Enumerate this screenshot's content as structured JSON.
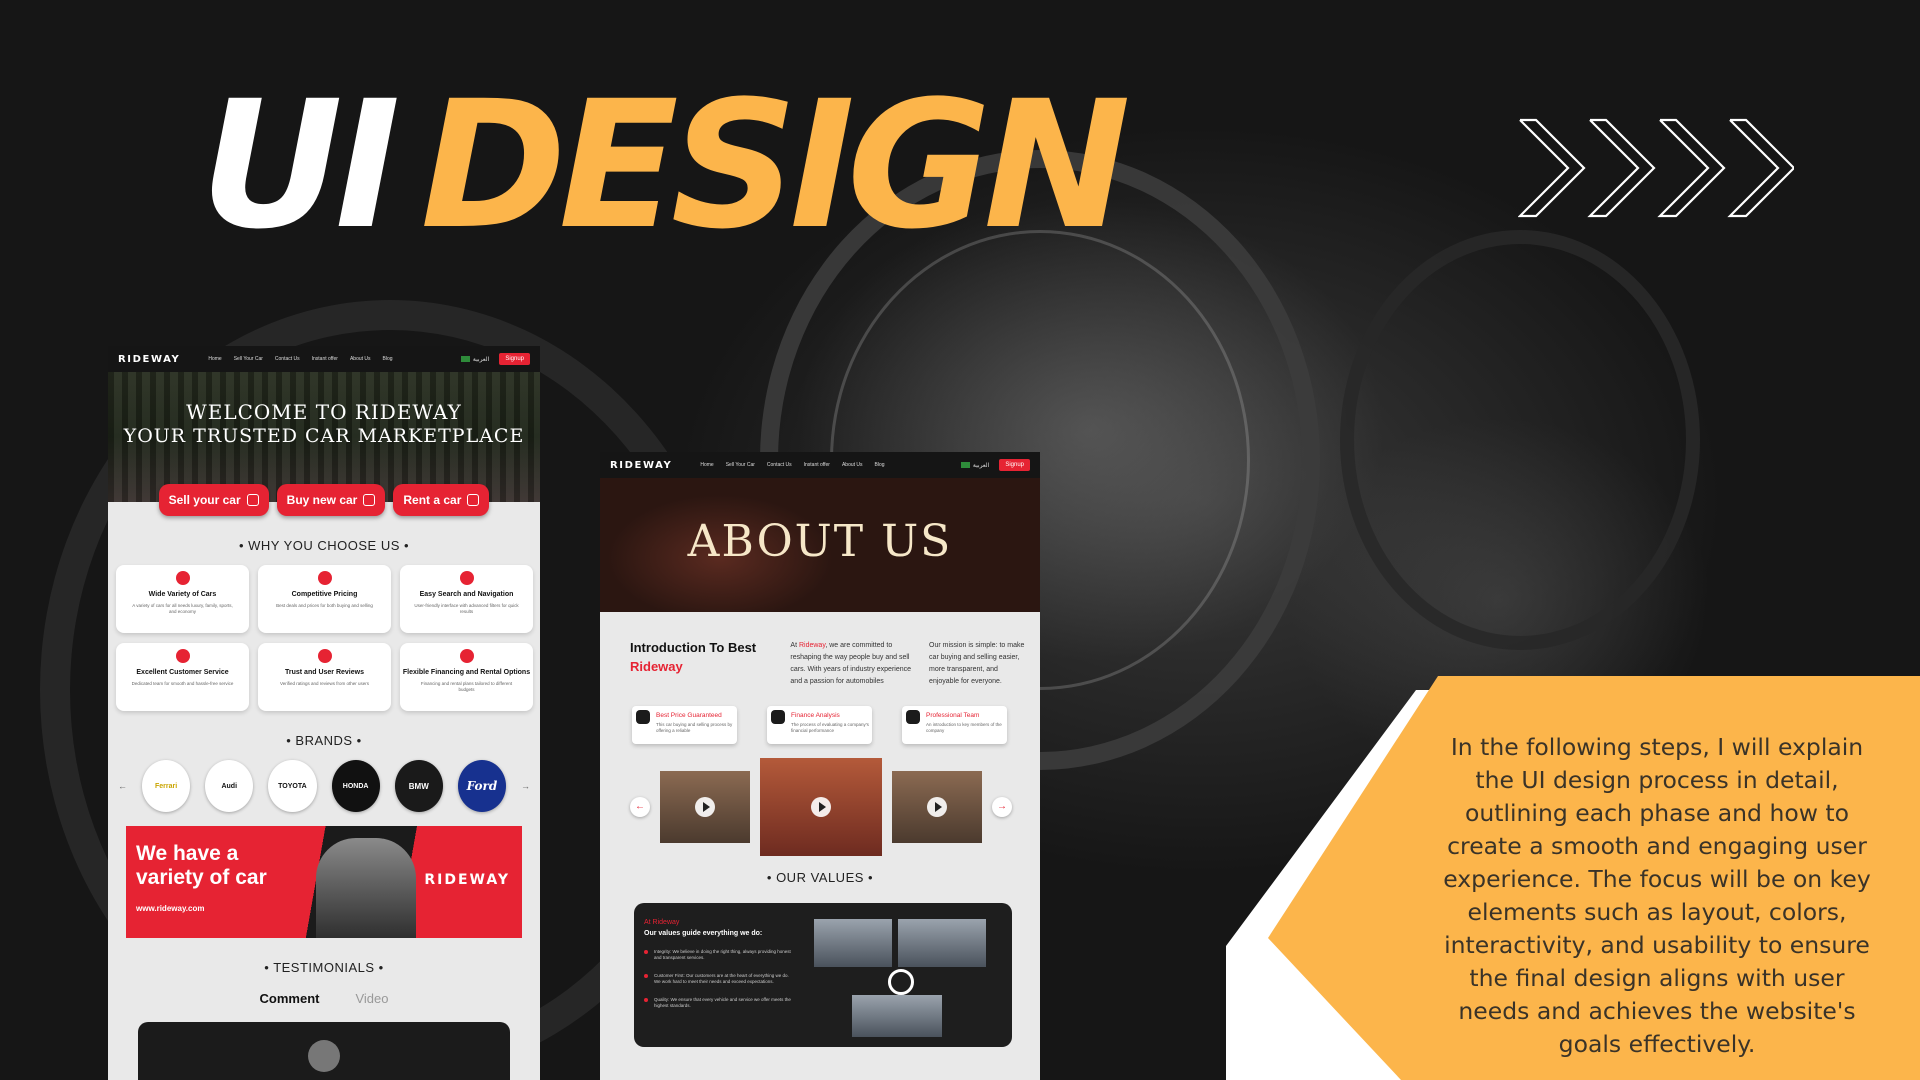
{
  "headline": {
    "part1": "UI",
    "part2": "DESIGN"
  },
  "colors": {
    "accent": "#fcb54b",
    "brand_red": "#e62333",
    "dark": "#1b1b1b"
  },
  "site_nav": {
    "logo": "RIDEWAY",
    "links": [
      "Home",
      "Sell Your Car",
      "Contact Us",
      "Instant offer",
      "About Us",
      "Blog"
    ],
    "language": "العربية",
    "signup": "Signup"
  },
  "home": {
    "hero_line1": "WELCOME TO RIDEWAY",
    "hero_line2": "YOUR TRUSTED CAR MARKETPLACE",
    "ctas": [
      "Sell your car",
      "Buy new car",
      "Rent a car"
    ],
    "why_title": "• WHY YOU CHOOSE US •",
    "features": [
      {
        "title": "Wide Variety of Cars",
        "desc": "A variety of cars for all needs luxury, family, sports, and economy",
        "icon": "car-variety-icon"
      },
      {
        "title": "Competitive Pricing",
        "desc": "Best deals and prices for both buying and selling",
        "icon": "price-tag-icon"
      },
      {
        "title": "Easy Search and Navigation",
        "desc": "User-friendly interface with advanced filters for quick results",
        "icon": "search-icon"
      },
      {
        "title": "Excellent Customer Service",
        "desc": "Dedicated team for smooth and hassle-free service",
        "icon": "support-agent-icon"
      },
      {
        "title": "Trust and User Reviews",
        "desc": "Verified ratings and reviews from other users",
        "icon": "reviews-icon"
      },
      {
        "title": "Flexible Financing and Rental Options",
        "desc": "Financing and rental plans tailored to different budgets",
        "icon": "financing-icon"
      }
    ],
    "brands_title": "• BRANDS •",
    "brands": [
      "Ferrari",
      "Audi",
      "TOYOTA",
      "HONDA",
      "BMW",
      "Ford"
    ],
    "banner": {
      "line1": "We have a",
      "line2": "variety of car",
      "url": "www.rideway.com",
      "logo": "RIDEWAY"
    },
    "testimonials_title": "• TESTIMONIALS •",
    "tabs": [
      "Comment",
      "Video"
    ]
  },
  "about": {
    "hero": "ABOUT US",
    "intro_heading_1": "Introduction To Best",
    "intro_heading_2": "Rideway",
    "intro_at": "At",
    "intro_brand": "Rideway",
    "intro_text": ", we are committed to reshaping the way people buy and sell cars. With years of industry experience and a passion for automobiles",
    "mission": "Our mission is simple: to make car buying and selling easier, more transparent, and enjoyable for everyone.",
    "features": [
      {
        "title": "Best Price Guaranteed",
        "desc": "This car buying and selling process by offering a reliable"
      },
      {
        "title": "Finance Analysis",
        "desc": "The process of evaluating a company's financial performance"
      },
      {
        "title": "Professional Team",
        "desc": "An introduction to key members of the company"
      }
    ],
    "values_title": "• OUR VALUES •",
    "values_brand": "At Rideway",
    "values_sub": "Our values guide everything we do:",
    "values": [
      "Integrity: We believe in doing the right thing, always providing honest and transparent services.",
      "Customer First: Our customers are at the heart of everything we do. We work hard to meet their needs and exceed expectations.",
      "Quality: We ensure that every vehicle and service we offer meets the highest standards."
    ]
  },
  "description": "In the following steps, I will explain the UI design process in detail, outlining each phase and how to create a smooth and engaging user experience. The focus will be on key elements such as layout, colors, interactivity, and usability to ensure the final design aligns with user needs and achieves the website's goals effectively."
}
